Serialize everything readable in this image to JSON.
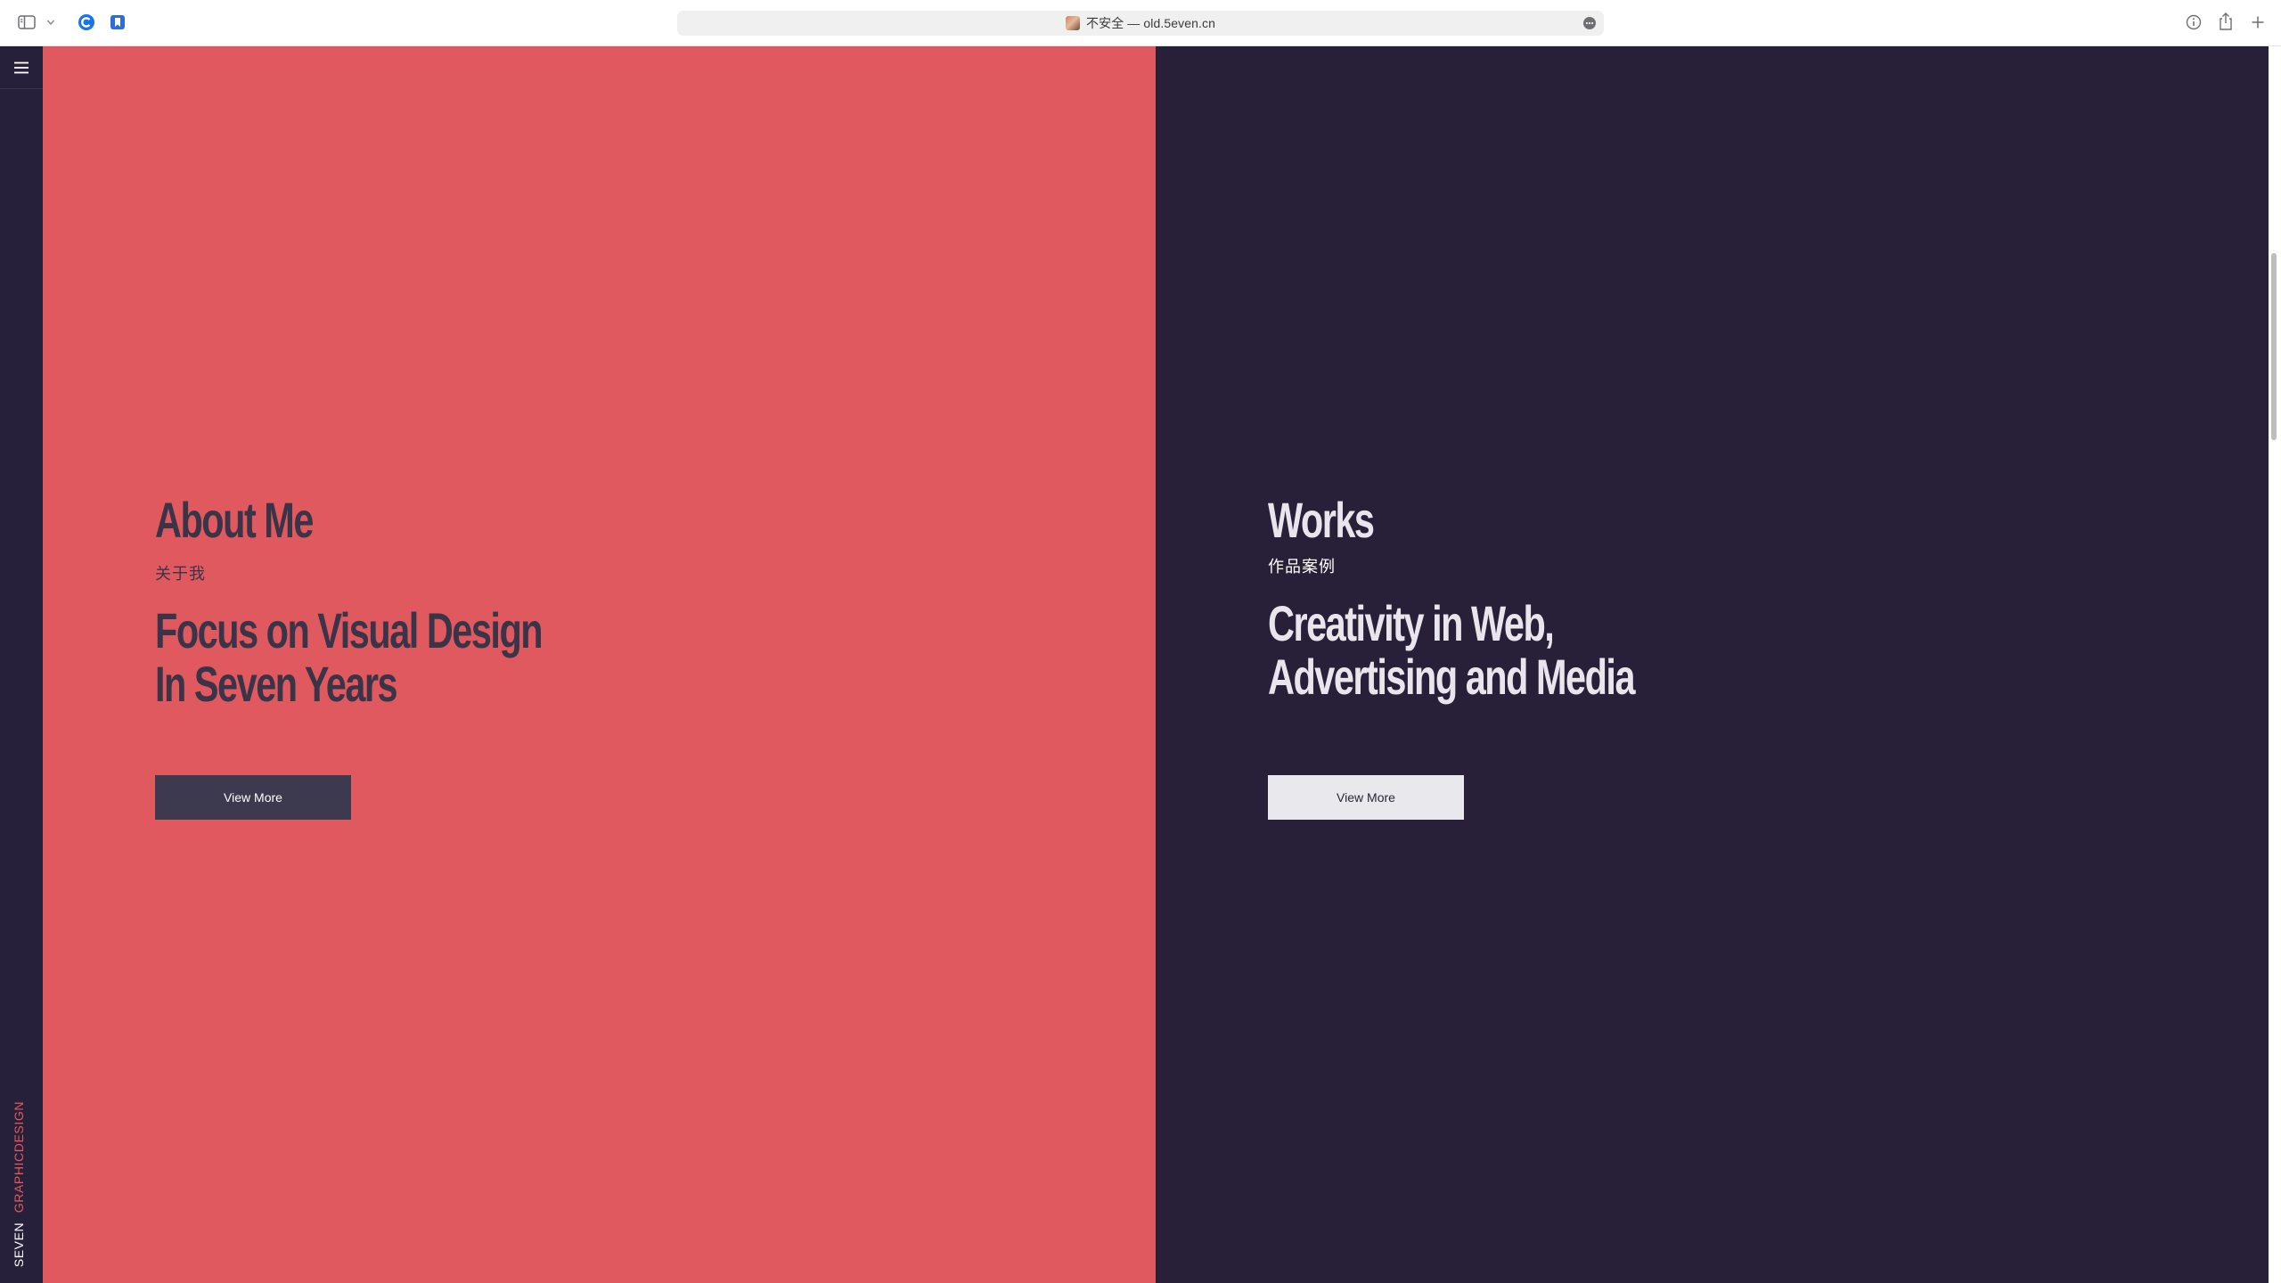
{
  "browser": {
    "address_bar": {
      "url_display": "不安全 — old.5even.cn"
    },
    "icons": {
      "sidebar_toggle": "sidebar-icon",
      "chevron": "chevron-down-icon",
      "extension_1": "extension-icon",
      "extension_2": "bookmark-extension-icon",
      "reader": "reader-icon",
      "info": "info-icon",
      "share": "share-icon",
      "new_tab": "plus-icon"
    }
  },
  "site": {
    "brand": {
      "word1": "SEVEN",
      "word2": "GRAPHICDESIGN"
    },
    "menu_icon": "hamburger-icon",
    "about": {
      "title": "About Me",
      "subtitle_cn": "关于我",
      "tagline_line1": "Focus on Visual Design",
      "tagline_line2": "In Seven Years",
      "button_label": "View More"
    },
    "works": {
      "title": "Works",
      "subtitle_cn": "作品案例",
      "tagline_line1": "Creativity in Web,",
      "tagline_line2": "Advertising and Media",
      "button_label": "View More"
    }
  },
  "colors": {
    "about_bg": "#e0595e",
    "works_bg": "#281f38",
    "rail_bg": "#27203a",
    "accent_red": "#e05a5f",
    "dark_text": "#3a3449"
  }
}
